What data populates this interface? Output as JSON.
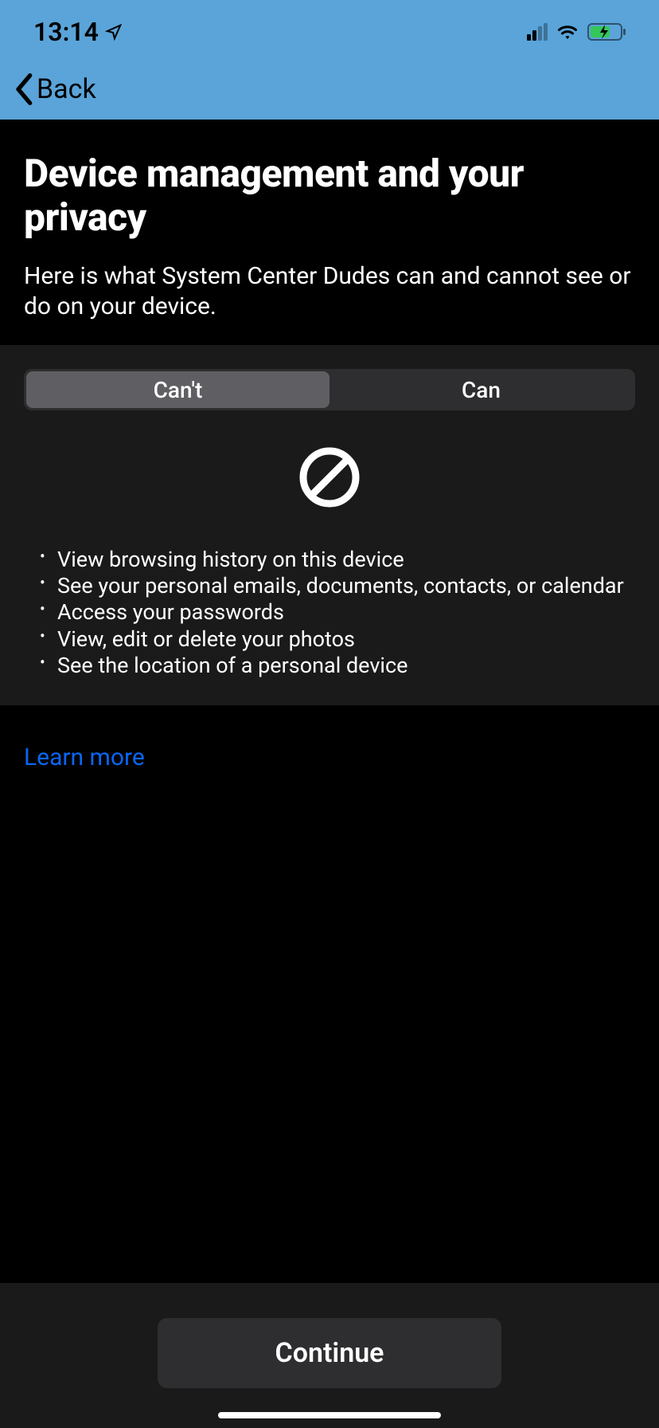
{
  "statusBar": {
    "time": "13:14"
  },
  "header": {
    "back_label": "Back"
  },
  "content": {
    "title": "Device management and your privacy",
    "subtitle": "Here is what System Center Dudes can and cannot see or do on your device."
  },
  "tabs": {
    "cant_label": "Can't",
    "can_label": "Can",
    "active": "cant"
  },
  "capabilities": {
    "cant": [
      "View browsing history on this device",
      "See your personal emails, documents, contacts, or calendar",
      "Access your passwords",
      "View, edit or delete your photos",
      "See the location of a personal device"
    ]
  },
  "learn_more": {
    "label": "Learn more"
  },
  "footer": {
    "continue_label": "Continue"
  }
}
